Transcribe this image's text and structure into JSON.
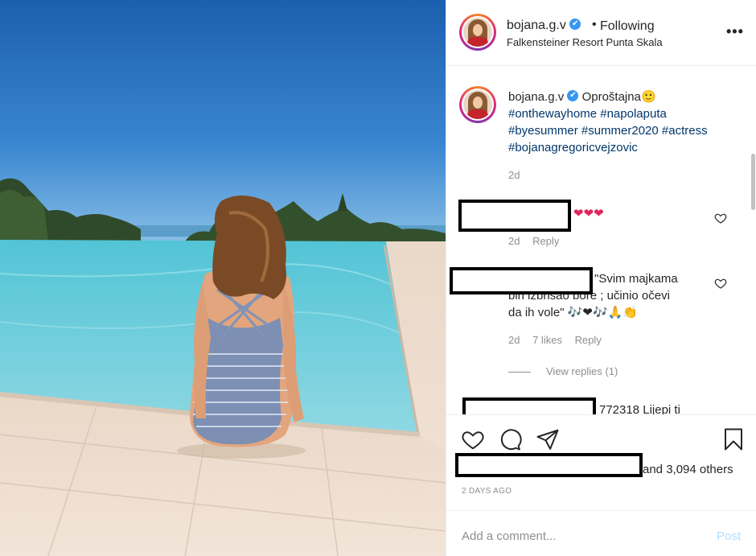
{
  "post": {
    "username": "bojana.g.v",
    "verified_mark": "✔",
    "separator": "•",
    "follow_status": "Following",
    "location": "Falkensteiner Resort Punta Skala",
    "more_icon": "more-horizontal-icon",
    "more_label": "•••"
  },
  "caption": {
    "username": "bojana.g.v",
    "text": "Oproštajna🙂",
    "hashtags_line1": "#onthewayhome #napolaputa",
    "hashtags_line2": "#byesummer #summer2020 #actress",
    "hashtags_line3": "#bojanagregoricvejzovic",
    "time": "2d"
  },
  "comments": [
    {
      "text": "❤❤❤",
      "time": "2d",
      "reply": "Reply"
    },
    {
      "text_line1": "\"Svim majkama",
      "text_line2": "bih izbrisao bore ; učinio očevi",
      "text_line3": "da ih vole\" 🎶❤🎶🙏👏",
      "time": "2d",
      "likes": "7 likes",
      "reply": "Reply",
      "view_replies": "View replies (1)"
    },
    {
      "text": "772318 Lijepi ti"
    }
  ],
  "likes": {
    "text": "and 3,094 others"
  },
  "timestamp": "2 DAYS AGO",
  "add_comment": {
    "placeholder": "Add a comment...",
    "post_label": "Post"
  },
  "colors": {
    "link_blue": "#00376b",
    "verified_blue": "#3897f0",
    "muted": "#8e8e8e",
    "post_disabled": "#b2dffc"
  }
}
